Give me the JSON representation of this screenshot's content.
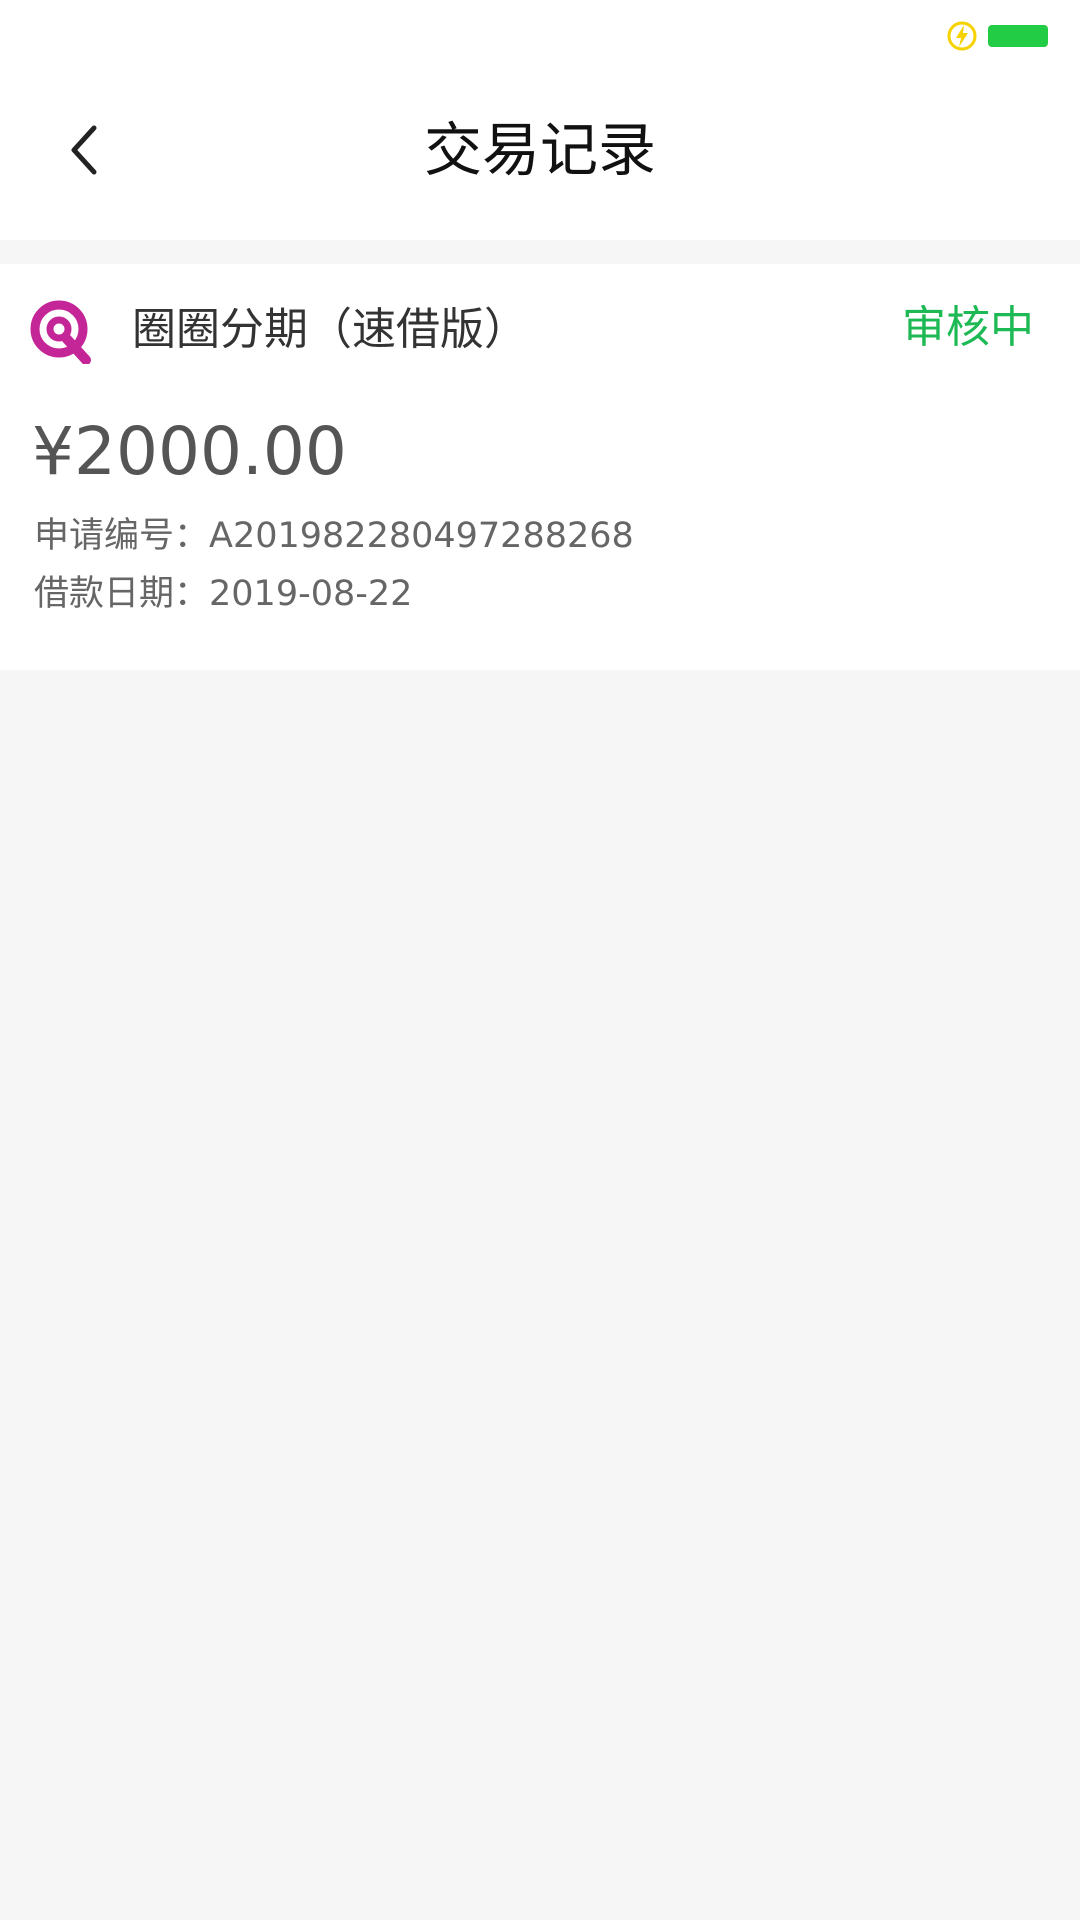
{
  "header": {
    "title": "交易记录"
  },
  "icons": {
    "back": "chevron-left-icon",
    "charging": "lightning-icon",
    "battery": "battery-icon",
    "logo": "product-logo-q"
  },
  "colors": {
    "status_green": "#1db954",
    "battery_green": "#22cc44",
    "charging_yellow": "#f5d200",
    "logo_magenta": "#c42597",
    "page_background": "#f6f6f6"
  },
  "records": [
    {
      "product_name": "圈圈分期（速借版）",
      "status": "审核中",
      "amount": "¥2000.00",
      "application_id_label": "申请编号：",
      "application_id": "A201982280497288268",
      "loan_date_label": "借款日期：",
      "loan_date": "2019-08-22"
    }
  ]
}
